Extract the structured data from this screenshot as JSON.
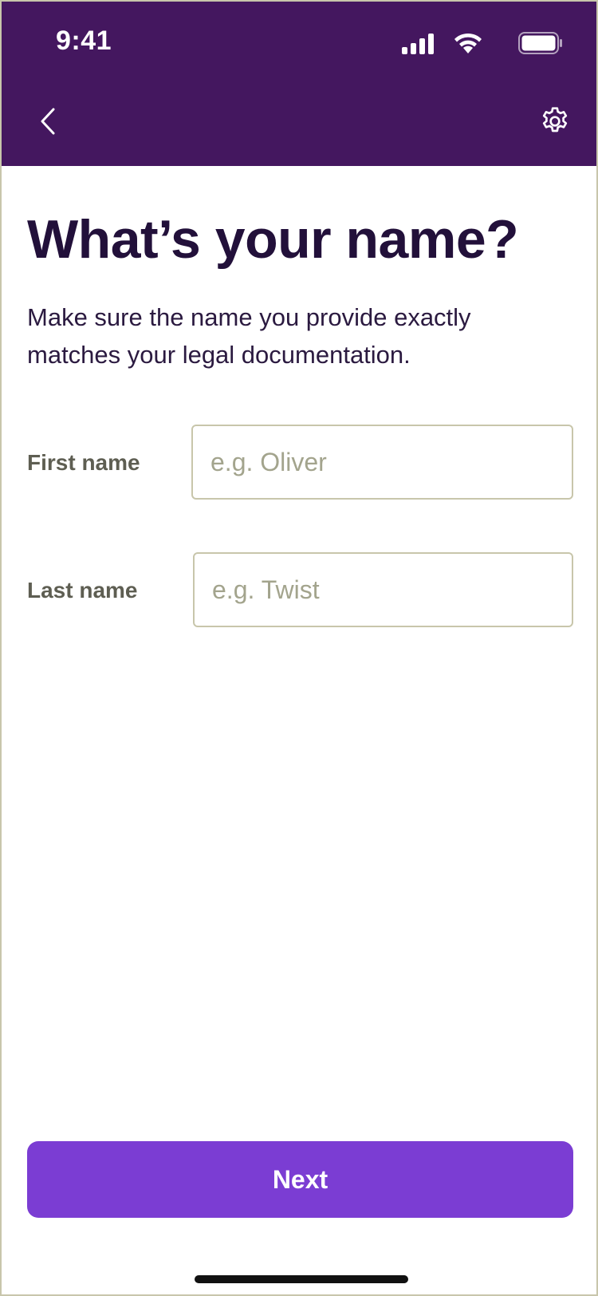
{
  "status_bar": {
    "time": "9:41",
    "icons": [
      "signal-icon",
      "wifi-icon",
      "battery-icon"
    ]
  },
  "nav": {
    "back_icon": "chevron-left-icon",
    "settings_icon": "gear-icon"
  },
  "content": {
    "title": "What’s your name?",
    "subtitle": "Make sure the name you provide exactly matches your legal documentation."
  },
  "form": {
    "first_name": {
      "label": "First name",
      "placeholder": "e.g. Oliver",
      "value": ""
    },
    "last_name": {
      "label": "Last name",
      "placeholder": "e.g. Twist",
      "value": ""
    }
  },
  "actions": {
    "next_label": "Next"
  },
  "colors": {
    "header_bg": "#44175f",
    "primary_button": "#7b3dd3",
    "title_text": "#22103a",
    "label_text": "#5e5e52",
    "input_border": "#c8c6ab",
    "placeholder_text": "#a3a48d"
  }
}
